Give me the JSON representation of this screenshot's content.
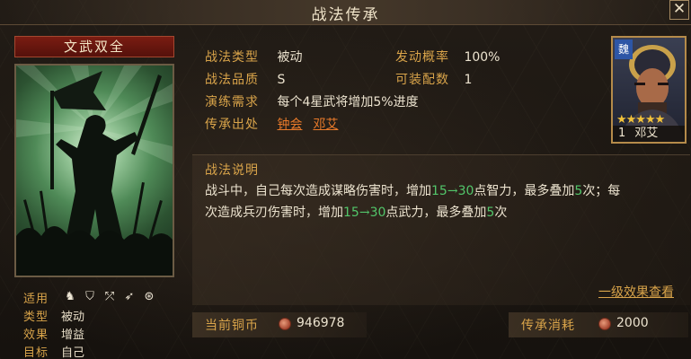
{
  "header": {
    "title": "战法传承",
    "close_label": "✕"
  },
  "skill": {
    "name": "文武双全",
    "meta": [
      {
        "key": "适用",
        "value": ""
      },
      {
        "key": "类型",
        "value": "被动"
      },
      {
        "key": "效果",
        "value": "增益"
      },
      {
        "key": "目标",
        "value": "自己"
      }
    ],
    "troop_icons": [
      "cavalry-icon",
      "shield-icon",
      "bow-icon",
      "spear-icon",
      "wheel-icon"
    ]
  },
  "info": {
    "type_label": "战法类型",
    "type_value": "被动",
    "quality_label": "战法品质",
    "quality_value": "S",
    "req_label": "演练需求",
    "req_value": "每个4星武将增加5%进度",
    "source_label": "传承出处",
    "sources": [
      "钟会",
      "邓艾"
    ],
    "rate_label": "发动概率",
    "rate_value": "100%",
    "equip_label": "可装配数",
    "equip_value": "1"
  },
  "general": {
    "faction": "魏",
    "stars": "★★★★★",
    "level": "1",
    "name": "邓艾"
  },
  "description": {
    "title": "战法说明",
    "line1_a": "战斗中，自己每次造成谋略伤害时，增加",
    "line1_from": "15",
    "line1_arrow": "→",
    "line1_to": "30",
    "line1_b": "点智力，最多叠加",
    "line1_max": "5",
    "line1_c": "次；每",
    "line2_a": "次造成兵刃伤害时，增加",
    "line2_from": "15",
    "line2_arrow": "→",
    "line2_to": "30",
    "line2_b": "点武力，最多叠加",
    "line2_max": "5",
    "line2_c": "次",
    "more_link": "一级效果查看"
  },
  "currency": {
    "current_label": "当前铜币",
    "current_value": "946978",
    "cost_label": "传承消耗",
    "cost_value": "2000"
  }
}
